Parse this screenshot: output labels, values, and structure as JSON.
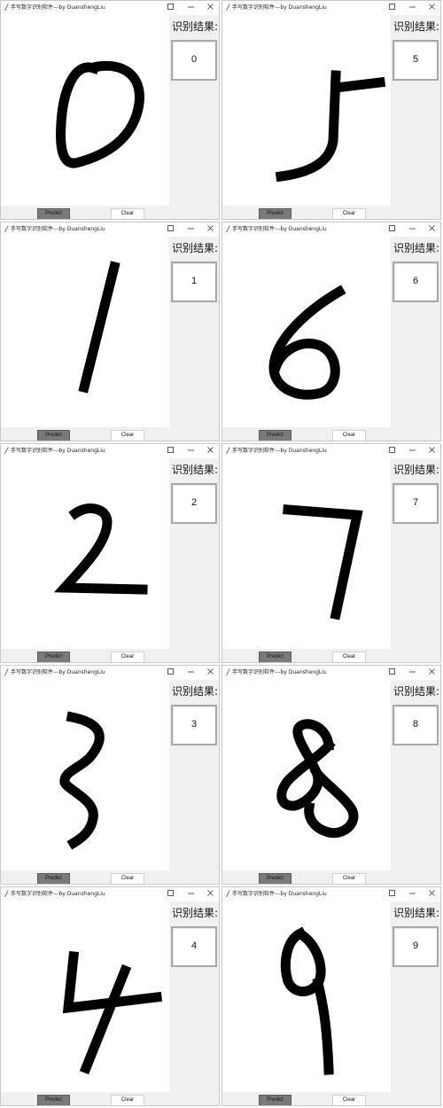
{
  "app": {
    "title": "手写数字识别软件---by DuanshengLiu",
    "result_label": "识别结果:",
    "predict_label": "Predict",
    "clear_label": "Clear",
    "window_controls": [
      "minimize-icon",
      "maximize-icon",
      "close-icon"
    ]
  },
  "windows": [
    {
      "result": "0"
    },
    {
      "result": "5"
    },
    {
      "result": "1"
    },
    {
      "result": "6"
    },
    {
      "result": "2"
    },
    {
      "result": "7"
    },
    {
      "result": "3"
    },
    {
      "result": "8"
    },
    {
      "result": "4"
    },
    {
      "result": "9"
    }
  ]
}
